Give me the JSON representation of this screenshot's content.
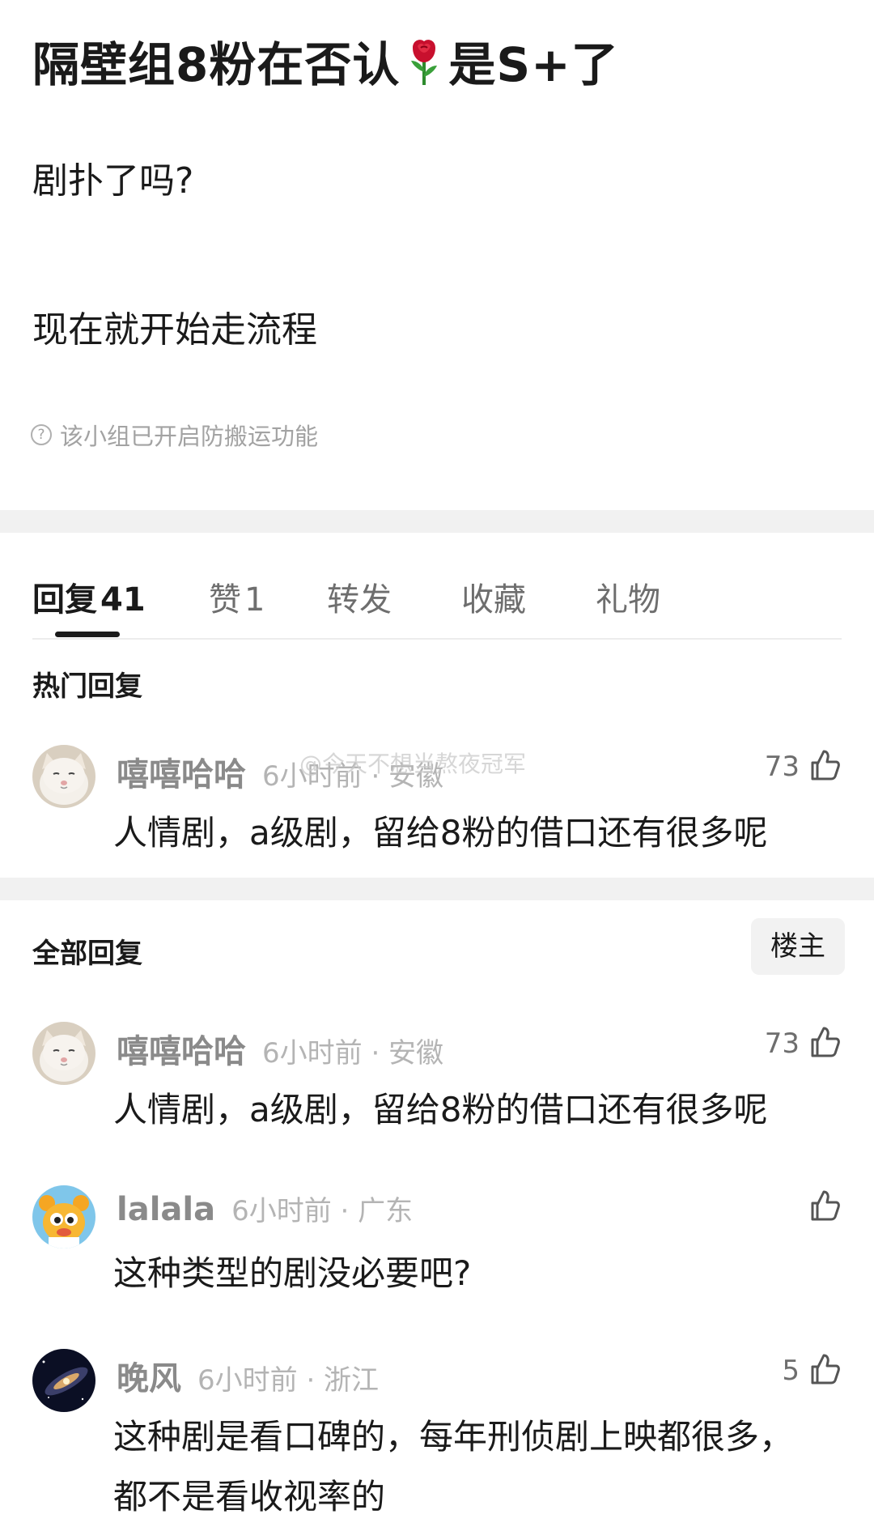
{
  "post": {
    "title_part1": "隔壁组8粉在否认",
    "title_part2": "是S+了",
    "rose_icon": "rose-icon",
    "line1": "剧扑了吗?",
    "line2": "现在就开始走流程",
    "notice": "该小组已开启防搬运功能",
    "notice_icon": "question-circle-icon"
  },
  "tabs": [
    {
      "label": "回复",
      "count": "41"
    },
    {
      "label": "赞",
      "count": "1"
    },
    {
      "label": "转发",
      "count": ""
    },
    {
      "label": "收藏",
      "count": ""
    },
    {
      "label": "礼物",
      "count": ""
    }
  ],
  "hot": {
    "title": "热门回复",
    "comments": [
      {
        "name": "嘻嘻哈哈",
        "time": "6小时前 · 安徽",
        "text": "人情剧，a级剧，留给8粉的借口还有很多呢",
        "likes": "73"
      }
    ]
  },
  "watermark": "@今天不想当熬夜冠军",
  "all": {
    "title": "全部回复",
    "louzhu": "楼主",
    "comments": [
      {
        "name": "嘻嘻哈哈",
        "time": "6小时前 · 安徽",
        "text": "人情剧，a级剧，留给8粉的借口还有很多呢",
        "likes": "73"
      },
      {
        "name": "lalala",
        "time": "6小时前 · 广东",
        "text": "这种类型的剧没必要吧?",
        "likes": ""
      },
      {
        "name": "晚风",
        "time": "6小时前 · 浙江",
        "text": "这种剧是看口碑的，每年刑侦剧上映都很多，都不是看收视率的",
        "likes": "5"
      }
    ]
  },
  "colors": {
    "text": "#1a1a1a",
    "muted": "#8a8a8a",
    "light": "#b4b4b4",
    "divider": "#f1f1f1",
    "rose": "#c8102e"
  }
}
